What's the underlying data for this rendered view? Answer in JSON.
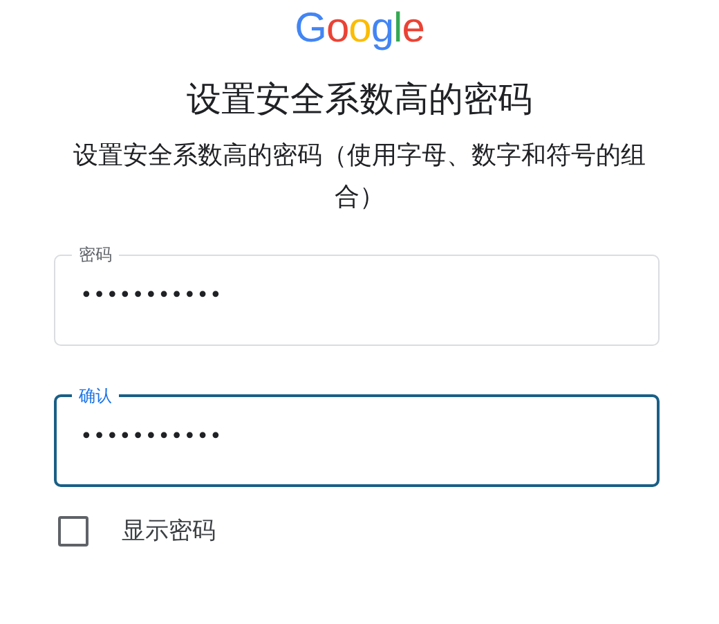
{
  "logo": "Google",
  "title": "设置安全系数高的密码",
  "subtitle": "设置安全系数高的密码（使用字母、数字和符号的组合）",
  "fields": [
    {
      "label": "密码",
      "value": "•••••••••••",
      "focused": false
    },
    {
      "label": "确认",
      "value": "•••••••••••",
      "focused": true
    }
  ],
  "show_password": {
    "label": "显示密码",
    "checked": false
  }
}
